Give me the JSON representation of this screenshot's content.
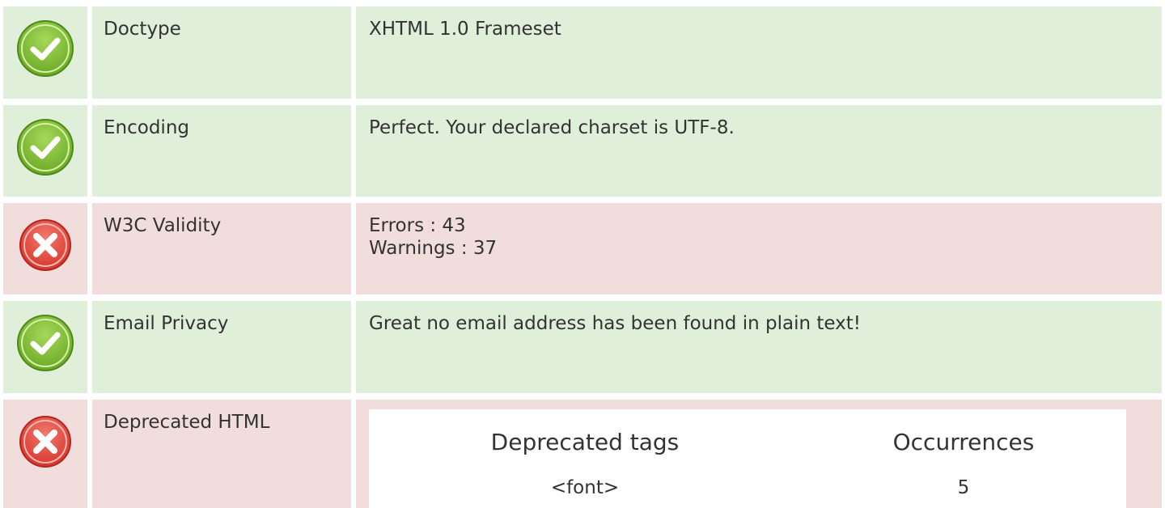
{
  "rows": [
    {
      "status": "pass",
      "icon": "check-circle-icon",
      "label": "Doctype",
      "value": "XHTML 1.0 Frameset"
    },
    {
      "status": "pass",
      "icon": "check-circle-icon",
      "label": "Encoding",
      "value": "Perfect. Your declared charset is UTF-8."
    },
    {
      "status": "fail",
      "icon": "x-circle-icon",
      "label": "W3C Validity",
      "value_lines": [
        "Errors : 43",
        "Warnings : 37"
      ]
    },
    {
      "status": "pass",
      "icon": "check-circle-icon",
      "label": "Email Privacy",
      "value": "Great no email address has been found in plain text!"
    },
    {
      "status": "fail",
      "icon": "x-circle-icon",
      "label": "Deprecated HTML",
      "table": {
        "headers": [
          "Deprecated tags",
          "Occurrences"
        ],
        "rows": [
          [
            "<font>",
            "5"
          ]
        ]
      }
    }
  ],
  "colors": {
    "pass_background": "#dfefd9",
    "fail_background": "#f2dddd",
    "pass_icon": "#7ab62f",
    "fail_icon": "#e0463d"
  }
}
